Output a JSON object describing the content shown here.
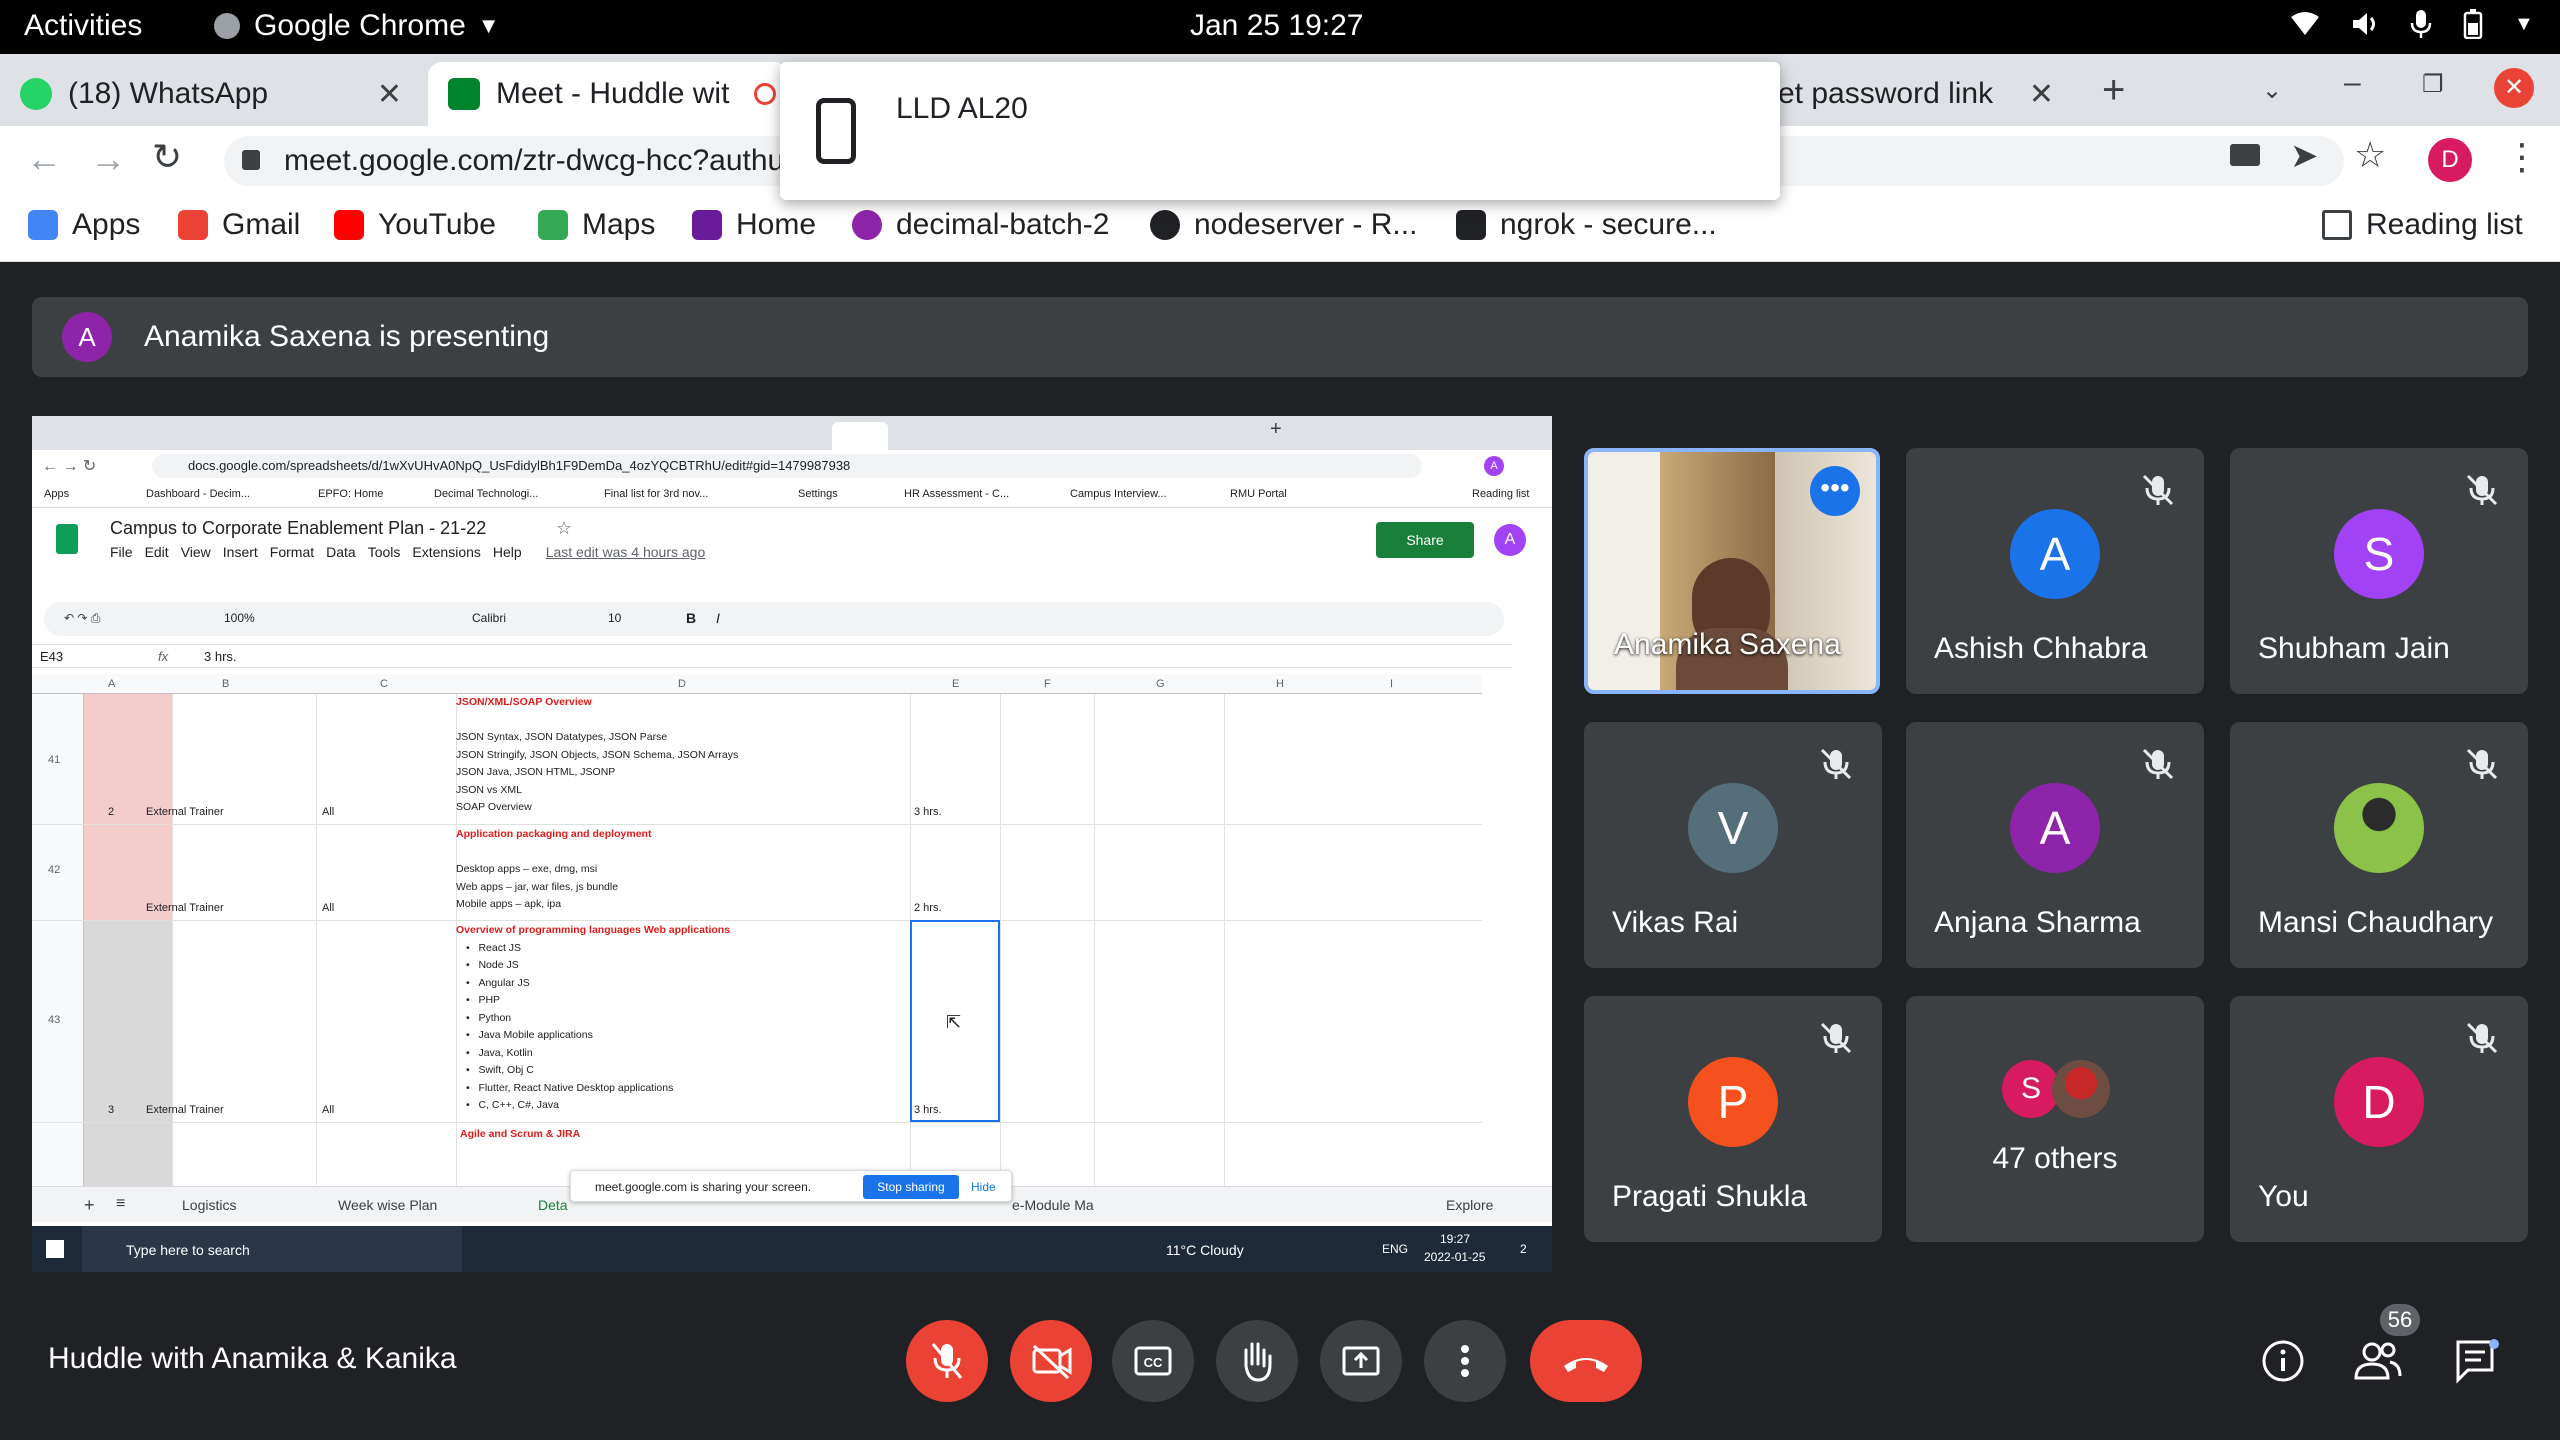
{
  "gnome": {
    "activities": "Activities",
    "app": "Google Chrome",
    "clock": "Jan 25  19:27"
  },
  "tabs": [
    {
      "label": "(18) WhatsApp",
      "color": "#25d366"
    },
    {
      "label": "Meet - Huddle wit",
      "color": "#00832d"
    },
    {
      "label": "et password link",
      "color": "#5f6368"
    }
  ],
  "popup": {
    "label": "LLD AL20"
  },
  "address": {
    "url": "meet.google.com/ztr-dwcg-hcc?authuse",
    "profile": "D"
  },
  "bookmarks": [
    {
      "label": "Apps",
      "icon": "apps-grid-icon",
      "color": "#4285f4"
    },
    {
      "label": "Gmail",
      "icon": "gmail-icon",
      "color": "#ea4335"
    },
    {
      "label": "YouTube",
      "icon": "youtube-icon",
      "color": "#ff0000"
    },
    {
      "label": "Maps",
      "icon": "maps-icon",
      "color": "#34a853"
    },
    {
      "label": "Home",
      "icon": "home-icon",
      "color": "#6a1b9a"
    },
    {
      "label": "decimal-batch-2",
      "icon": "decimal-icon",
      "color": "#8e24aa"
    },
    {
      "label": "nodeserver - R...",
      "icon": "replit-icon",
      "color": "#202124"
    },
    {
      "label": "ngrok - secure...",
      "icon": "ngrok-icon",
      "color": "#202124"
    }
  ],
  "reading_list": "Reading list",
  "meet": {
    "presenter_initial": "A",
    "presenting_text": "Anamika Saxena is presenting",
    "meeting_title": "Huddle with Anamika & Kanika",
    "people_count": "56"
  },
  "participants": [
    {
      "name": "Anamika Saxena",
      "initial": "",
      "color": "#8a6d4f",
      "muted": false,
      "video": true
    },
    {
      "name": "Ashish Chhabra",
      "initial": "A",
      "color": "#1a73e8",
      "muted": true
    },
    {
      "name": "Shubham Jain",
      "initial": "S",
      "color": "#a142f4",
      "muted": true
    },
    {
      "name": "Vikas Rai",
      "initial": "V",
      "color": "#546e7a",
      "muted": true
    },
    {
      "name": "Anjana Sharma",
      "initial": "A",
      "color": "#8e24aa",
      "muted": true
    },
    {
      "name": "Mansi Chaudhary",
      "initial": "",
      "color": "#7cb342",
      "muted": true
    },
    {
      "name": "Pragati Shukla",
      "initial": "P",
      "color": "#f4511e",
      "muted": true
    },
    {
      "name": "47 others",
      "initial": "S",
      "color": "#d81b60",
      "muted": false
    },
    {
      "name": "You",
      "initial": "D",
      "color": "#d81b60",
      "muted": true
    }
  ],
  "shared": {
    "url": "docs.google.com/spreadsheets/d/1wXvUHvA0NpQ_UsFdidylBh1F9DemDa_4ozYQCBTRhU/edit#gid=1479987938",
    "doc_title": "Campus to Corporate Enablement Plan - 21-22",
    "menus": [
      "File",
      "Edit",
      "View",
      "Insert",
      "Format",
      "Data",
      "Tools",
      "Extensions",
      "Help"
    ],
    "last_edit": "Last edit was 4 hours ago",
    "share": "Share",
    "cell_ref": "E43",
    "formula": "3 hrs.",
    "zoom": "100%",
    "font": "Calibri",
    "font_size": "10",
    "columns": [
      "A",
      "B",
      "C",
      "D",
      "E",
      "F",
      "G",
      "H",
      "I"
    ],
    "bookmarks": [
      "Apps",
      "Dashboard - Decim...",
      "EPFO: Home",
      "Decimal Technologi...",
      "Final list for 3rd nov...",
      "Settings",
      "HR Assessment - C...",
      "Campus Interview...",
      "RMU Portal"
    ],
    "reading_list": "Reading list",
    "rows": [
      {
        "num": "41",
        "a": "2",
        "b": "External Trainer",
        "c": "All",
        "title": "JSON/XML/SOAP Overview",
        "lines": [
          "",
          "JSON Syntax, JSON Datatypes, JSON Parse",
          "JSON Stringify, JSON Objects, JSON Schema, JSON Arrays",
          "JSON Java, JSON HTML, JSONP",
          "JSON vs XML",
          "SOAP Overview"
        ],
        "e": "3 hrs."
      },
      {
        "num": "42",
        "a": "",
        "b": "External Trainer",
        "c": "All",
        "title": "Application packaging and deployment",
        "lines": [
          "",
          "Desktop apps – exe, dmg, msi",
          "Web apps – jar, war files, js bundle",
          "Mobile apps – apk, ipa"
        ],
        "e": "2 hrs."
      },
      {
        "num": "43",
        "a": "3",
        "b": "External Trainer",
        "c": "All",
        "title": "Overview of programming languages Web applications",
        "lines": [
          "React JS",
          "Node JS",
          "Angular JS",
          "PHP",
          "Python",
          "Java Mobile applications",
          "Java, Kotlin",
          "Swift, Obj C",
          "Flutter, React Native Desktop applications",
          "C, C++, C#, Java"
        ],
        "e": "3 hrs."
      },
      {
        "num": "",
        "a": "",
        "b": "",
        "c": "",
        "title": "Agile and Scrum & JIRA",
        "lines": [],
        "e": ""
      }
    ],
    "sheet_tabs": [
      "Logistics",
      "Week wise Plan",
      "Deta",
      "e-Module Ma"
    ],
    "explore": "Explore",
    "sharing_bar": {
      "text": "meet.google.com is sharing your screen.",
      "stop": "Stop sharing",
      "hide": "Hide"
    },
    "taskbar": {
      "search": "Type here to search",
      "weather": "11°C  Cloudy",
      "lang": "ENG",
      "time": "19:27",
      "date": "2022-01-25",
      "notif": "2"
    }
  }
}
